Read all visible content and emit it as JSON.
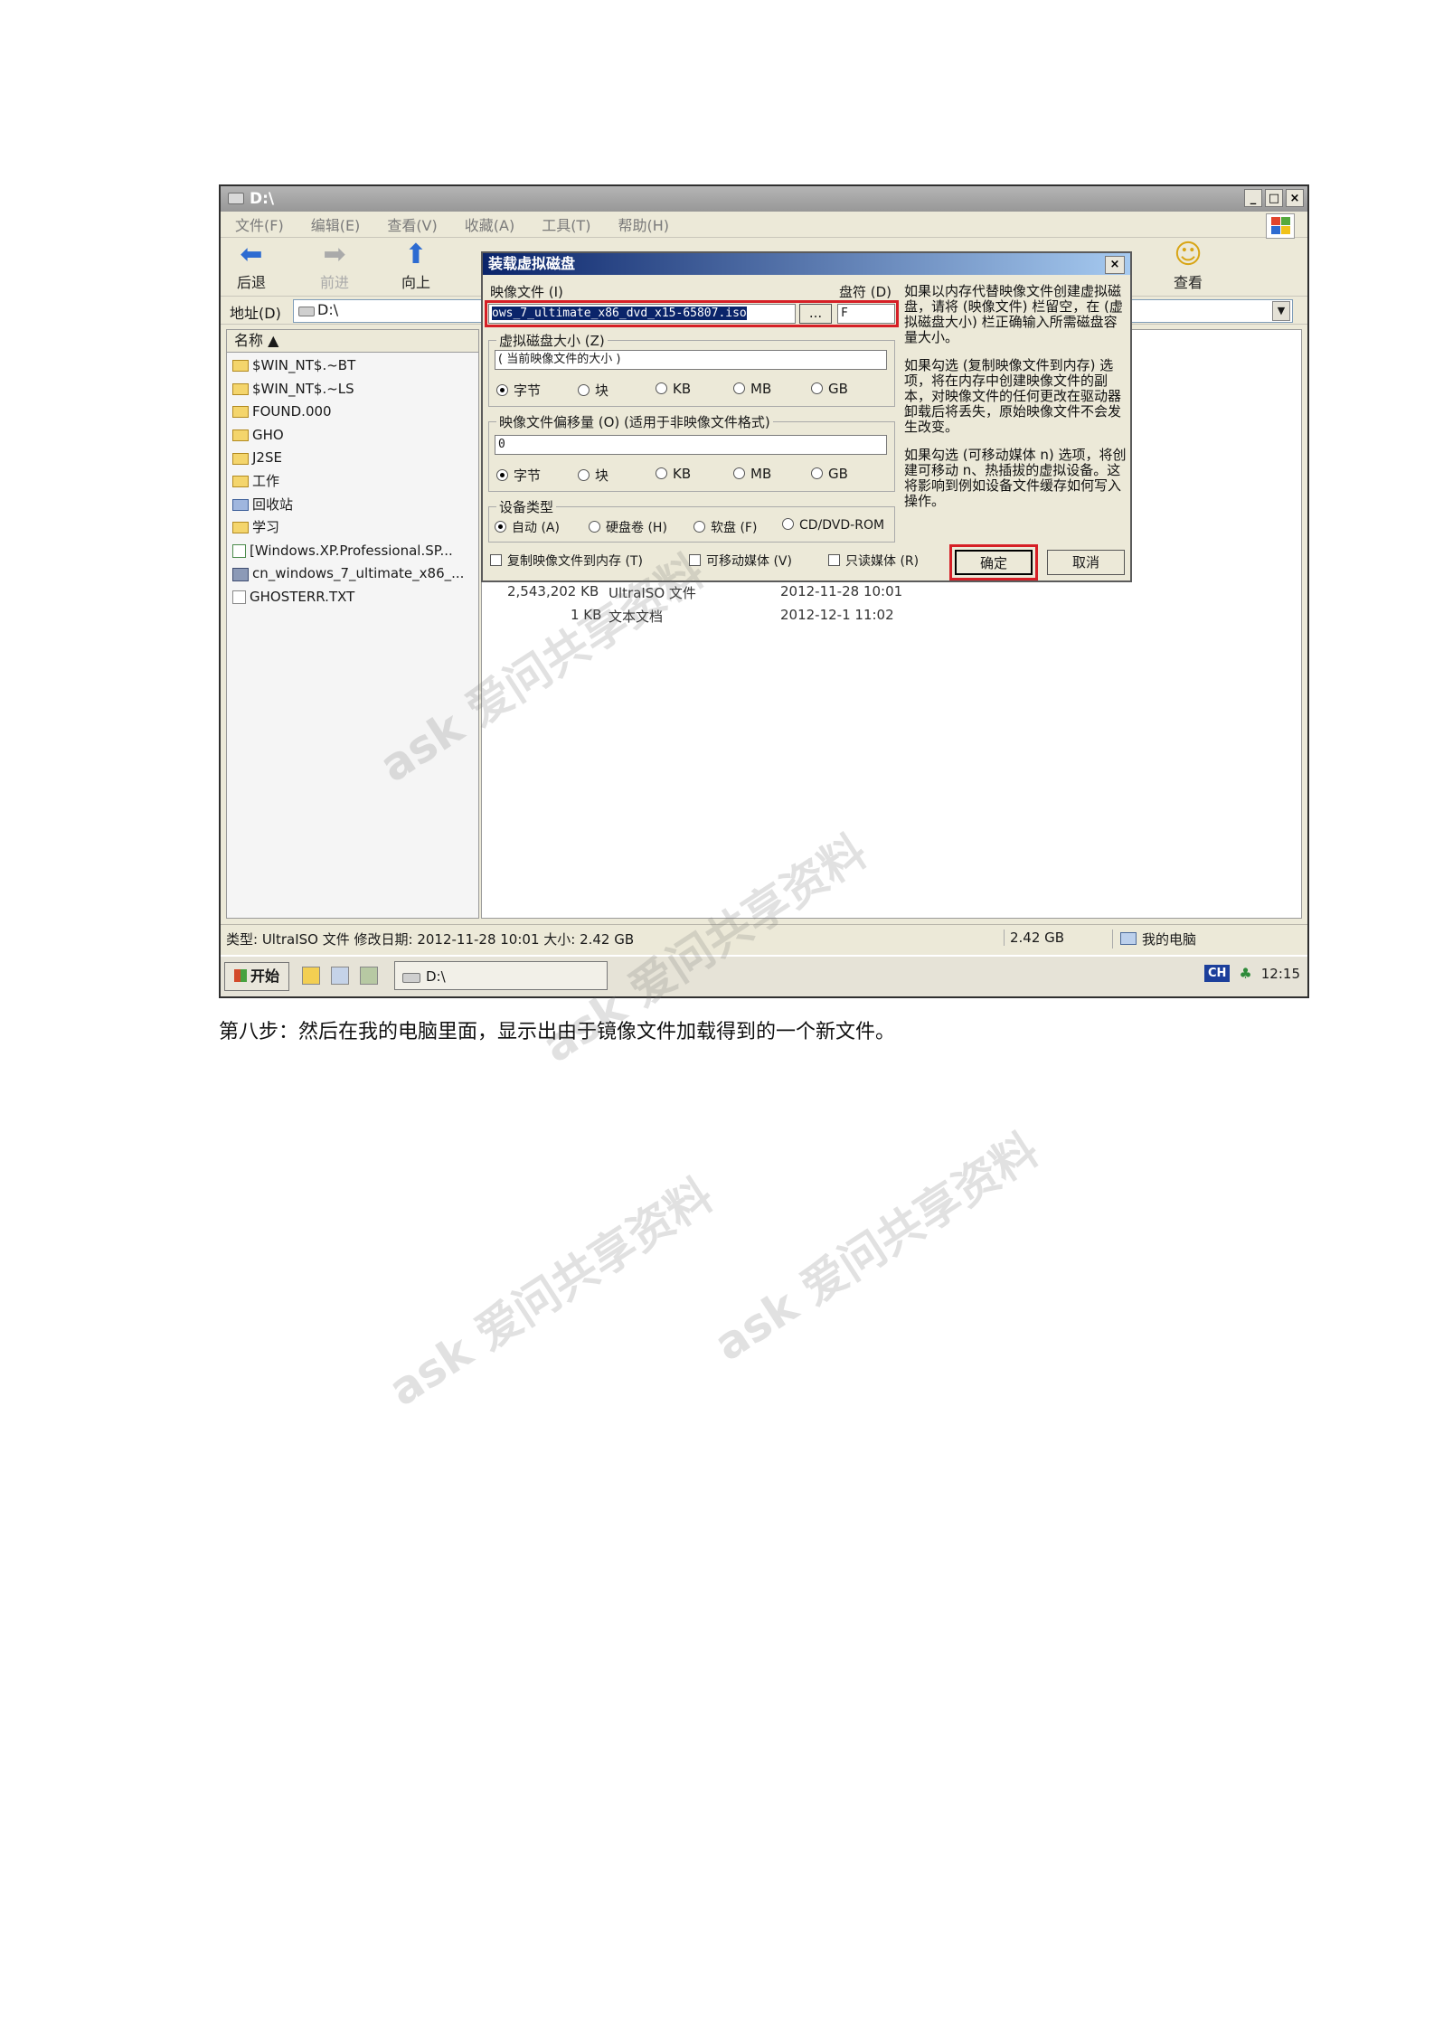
{
  "window": {
    "title": "D:\\",
    "controls": [
      "_",
      "□",
      "×"
    ],
    "menu": [
      "文件(F)",
      "编辑(E)",
      "查看(V)",
      "收藏(A)",
      "工具(T)",
      "帮助(H)"
    ]
  },
  "toolbar": {
    "back": "后退",
    "forward": "前进",
    "up": "向上",
    "view": "查看"
  },
  "address": {
    "label": "地址(D)",
    "value": "D:\\"
  },
  "file_list": {
    "column_name": "名称",
    "items": [
      "$WIN_NT$.~BT",
      "$WIN_NT$.~LS",
      "FOUND.000",
      "GHO",
      "J2SE",
      "工作",
      "回收站",
      "学习",
      "[Windows.XP.Professional.SP...",
      "cn_windows_7_ultimate_x86_...",
      "GHOSTERR.TXT"
    ],
    "details": [
      {
        "size": "2,543,202 KB",
        "type": "UltraISO 文件",
        "date": "2012-11-28 10:01"
      },
      {
        "size": "1 KB",
        "type": "文本文档",
        "date": "2012-12-1 11:02"
      }
    ]
  },
  "dialog": {
    "title": "装载虚拟磁盘",
    "image_file_label": "映像文件 (I)",
    "image_file_value": "ows_7_ultimate_x86_dvd_x15-65807.iso",
    "browse": "...",
    "drive_label": "盘符 (D)",
    "drive_value": "F",
    "size_group": "虚拟磁盘大小 (Z)",
    "size_value": "( 当前映像文件的大小 )",
    "units": [
      "字节",
      "块",
      "KB",
      "MB",
      "GB"
    ],
    "offset_group": "映像文件偏移量 (O)  (适用于非映像文件格式)",
    "offset_value": "0",
    "device_group": "设备类型",
    "device_types": [
      "自动 (A)",
      "硬盘卷 (H)",
      "软盘 (F)",
      "CD/DVD-ROM"
    ],
    "copy_to_memory": "复制映像文件到内存 (T)",
    "removable": "可移动媒体 (V)",
    "readonly": "只读媒体 (R)",
    "ok": "确定",
    "cancel": "取消",
    "help1": "如果以内存代替映像文件创建虚拟磁盘，请将 (映像文件) 栏留空，在 (虚拟磁盘大小) 栏正确输入所需磁盘容量大小。",
    "help2": "如果勾选 (复制映像文件到内存) 选项，将在内存中创建映像文件的副本，对映像文件的任何更改在驱动器卸载后将丢失，原始映像文件不会发生改变。",
    "help3": "如果勾选 (可移动媒体 n) 选项，将创建可移动 n、热插拔的虚拟设备。这将影响到例如设备文件缓存如何写入操作。"
  },
  "status": {
    "info": "类型: UltraISO 文件 修改日期: 2012-11-28 10:01 大小: 2.42 GB",
    "size": "2.42 GB",
    "location": "我的电脑"
  },
  "taskbar": {
    "start": "开始",
    "task": "D:\\",
    "lang": "CH",
    "clock": "12:15"
  },
  "caption": "第八步：然后在我的电脑里面，显示出由于镜像文件加载得到的一个新文件。",
  "watermark": "ask 爱问共享资料"
}
